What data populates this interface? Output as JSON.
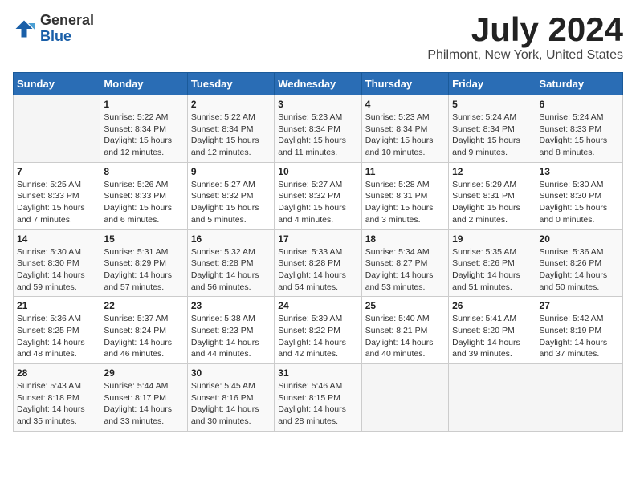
{
  "header": {
    "logo_general": "General",
    "logo_blue": "Blue",
    "title": "July 2024",
    "subtitle": "Philmont, New York, United States"
  },
  "days_of_week": [
    "Sunday",
    "Monday",
    "Tuesday",
    "Wednesday",
    "Thursday",
    "Friday",
    "Saturday"
  ],
  "weeks": [
    [
      {
        "day": "",
        "info": ""
      },
      {
        "day": "1",
        "info": "Sunrise: 5:22 AM\nSunset: 8:34 PM\nDaylight: 15 hours\nand 12 minutes."
      },
      {
        "day": "2",
        "info": "Sunrise: 5:22 AM\nSunset: 8:34 PM\nDaylight: 15 hours\nand 12 minutes."
      },
      {
        "day": "3",
        "info": "Sunrise: 5:23 AM\nSunset: 8:34 PM\nDaylight: 15 hours\nand 11 minutes."
      },
      {
        "day": "4",
        "info": "Sunrise: 5:23 AM\nSunset: 8:34 PM\nDaylight: 15 hours\nand 10 minutes."
      },
      {
        "day": "5",
        "info": "Sunrise: 5:24 AM\nSunset: 8:34 PM\nDaylight: 15 hours\nand 9 minutes."
      },
      {
        "day": "6",
        "info": "Sunrise: 5:24 AM\nSunset: 8:33 PM\nDaylight: 15 hours\nand 8 minutes."
      }
    ],
    [
      {
        "day": "7",
        "info": "Sunrise: 5:25 AM\nSunset: 8:33 PM\nDaylight: 15 hours\nand 7 minutes."
      },
      {
        "day": "8",
        "info": "Sunrise: 5:26 AM\nSunset: 8:33 PM\nDaylight: 15 hours\nand 6 minutes."
      },
      {
        "day": "9",
        "info": "Sunrise: 5:27 AM\nSunset: 8:32 PM\nDaylight: 15 hours\nand 5 minutes."
      },
      {
        "day": "10",
        "info": "Sunrise: 5:27 AM\nSunset: 8:32 PM\nDaylight: 15 hours\nand 4 minutes."
      },
      {
        "day": "11",
        "info": "Sunrise: 5:28 AM\nSunset: 8:31 PM\nDaylight: 15 hours\nand 3 minutes."
      },
      {
        "day": "12",
        "info": "Sunrise: 5:29 AM\nSunset: 8:31 PM\nDaylight: 15 hours\nand 2 minutes."
      },
      {
        "day": "13",
        "info": "Sunrise: 5:30 AM\nSunset: 8:30 PM\nDaylight: 15 hours\nand 0 minutes."
      }
    ],
    [
      {
        "day": "14",
        "info": "Sunrise: 5:30 AM\nSunset: 8:30 PM\nDaylight: 14 hours\nand 59 minutes."
      },
      {
        "day": "15",
        "info": "Sunrise: 5:31 AM\nSunset: 8:29 PM\nDaylight: 14 hours\nand 57 minutes."
      },
      {
        "day": "16",
        "info": "Sunrise: 5:32 AM\nSunset: 8:28 PM\nDaylight: 14 hours\nand 56 minutes."
      },
      {
        "day": "17",
        "info": "Sunrise: 5:33 AM\nSunset: 8:28 PM\nDaylight: 14 hours\nand 54 minutes."
      },
      {
        "day": "18",
        "info": "Sunrise: 5:34 AM\nSunset: 8:27 PM\nDaylight: 14 hours\nand 53 minutes."
      },
      {
        "day": "19",
        "info": "Sunrise: 5:35 AM\nSunset: 8:26 PM\nDaylight: 14 hours\nand 51 minutes."
      },
      {
        "day": "20",
        "info": "Sunrise: 5:36 AM\nSunset: 8:26 PM\nDaylight: 14 hours\nand 50 minutes."
      }
    ],
    [
      {
        "day": "21",
        "info": "Sunrise: 5:36 AM\nSunset: 8:25 PM\nDaylight: 14 hours\nand 48 minutes."
      },
      {
        "day": "22",
        "info": "Sunrise: 5:37 AM\nSunset: 8:24 PM\nDaylight: 14 hours\nand 46 minutes."
      },
      {
        "day": "23",
        "info": "Sunrise: 5:38 AM\nSunset: 8:23 PM\nDaylight: 14 hours\nand 44 minutes."
      },
      {
        "day": "24",
        "info": "Sunrise: 5:39 AM\nSunset: 8:22 PM\nDaylight: 14 hours\nand 42 minutes."
      },
      {
        "day": "25",
        "info": "Sunrise: 5:40 AM\nSunset: 8:21 PM\nDaylight: 14 hours\nand 40 minutes."
      },
      {
        "day": "26",
        "info": "Sunrise: 5:41 AM\nSunset: 8:20 PM\nDaylight: 14 hours\nand 39 minutes."
      },
      {
        "day": "27",
        "info": "Sunrise: 5:42 AM\nSunset: 8:19 PM\nDaylight: 14 hours\nand 37 minutes."
      }
    ],
    [
      {
        "day": "28",
        "info": "Sunrise: 5:43 AM\nSunset: 8:18 PM\nDaylight: 14 hours\nand 35 minutes."
      },
      {
        "day": "29",
        "info": "Sunrise: 5:44 AM\nSunset: 8:17 PM\nDaylight: 14 hours\nand 33 minutes."
      },
      {
        "day": "30",
        "info": "Sunrise: 5:45 AM\nSunset: 8:16 PM\nDaylight: 14 hours\nand 30 minutes."
      },
      {
        "day": "31",
        "info": "Sunrise: 5:46 AM\nSunset: 8:15 PM\nDaylight: 14 hours\nand 28 minutes."
      },
      {
        "day": "",
        "info": ""
      },
      {
        "day": "",
        "info": ""
      },
      {
        "day": "",
        "info": ""
      }
    ]
  ]
}
